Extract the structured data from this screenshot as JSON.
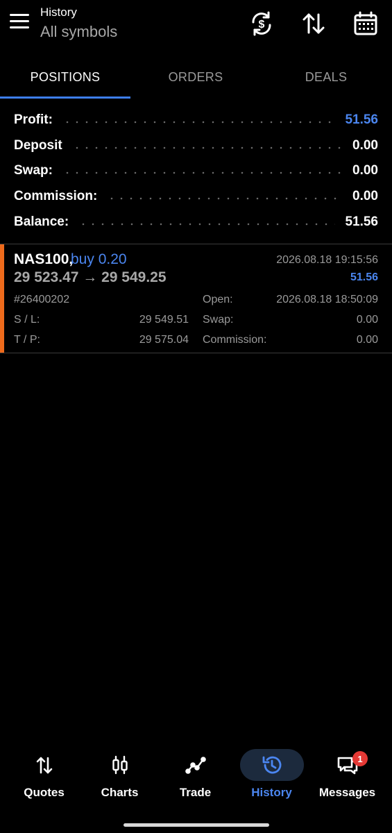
{
  "header": {
    "title": "History",
    "subtitle": "All symbols",
    "icons": [
      "currency-refresh-icon",
      "sort-icon",
      "calendar-icon"
    ]
  },
  "tabs": [
    {
      "label": "POSITIONS",
      "active": true
    },
    {
      "label": "ORDERS",
      "active": false
    },
    {
      "label": "DEALS",
      "active": false
    }
  ],
  "summary": {
    "profit": {
      "label": "Profit:",
      "value": "51.56"
    },
    "deposit": {
      "label": "Deposit",
      "value": "0.00"
    },
    "swap": {
      "label": "Swap:",
      "value": "0.00"
    },
    "commission": {
      "label": "Commission:",
      "value": "0.00"
    },
    "balance": {
      "label": "Balance:",
      "value": "51.56"
    }
  },
  "position": {
    "symbol": "NAS100,",
    "type": "buy 0.20",
    "close_time": "2026.08.18 19:15:56",
    "prices": "29 523.47 → 29 549.25",
    "profit": "51.56",
    "ticket": "#26400202",
    "open_label": "Open:",
    "open_time": "2026.08.18 18:50:09",
    "sl_label": "S / L:",
    "sl_value": "29 549.51",
    "swap_label": "Swap:",
    "swap_value": "0.00",
    "tp_label": "T / P:",
    "tp_value": "29 575.04",
    "commission_label": "Commission:",
    "commission_value": "0.00",
    "accent_color": "#ee6a1b"
  },
  "nav": [
    {
      "label": "Quotes",
      "icon": "quotes-arrows-icon",
      "active": false
    },
    {
      "label": "Charts",
      "icon": "candlestick-icon",
      "active": false
    },
    {
      "label": "Trade",
      "icon": "trade-line-icon",
      "active": false
    },
    {
      "label": "History",
      "icon": "history-clock-icon",
      "active": true
    },
    {
      "label": "Messages",
      "icon": "chat-icon",
      "active": false,
      "badge": "1"
    }
  ],
  "colors": {
    "accent": "#4b86f0",
    "background": "#000000",
    "active_nav_pill": "#1c2a3d",
    "badge": "#e53935"
  }
}
